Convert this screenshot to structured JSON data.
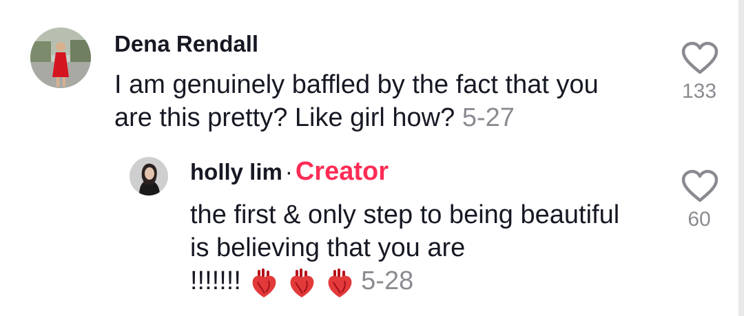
{
  "comments": [
    {
      "author": "Dena Rendall",
      "text": "I am genuinely baffled by the fact that you are this pretty? Like girl how?",
      "time": "5-27",
      "likes": "133"
    }
  ],
  "reply": {
    "author": "holly lim",
    "separator": "·",
    "badge": "Creator",
    "text": "the first & only step to being beautiful is believing that you are",
    "exclaim": "!!!!!!!",
    "emoji": [
      "anatomical-heart",
      "anatomical-heart",
      "anatomical-heart"
    ],
    "time": "5-28",
    "likes": "60"
  },
  "colors": {
    "accent": "#fe2c55",
    "muted": "#8a8b91",
    "text": "#161823"
  }
}
